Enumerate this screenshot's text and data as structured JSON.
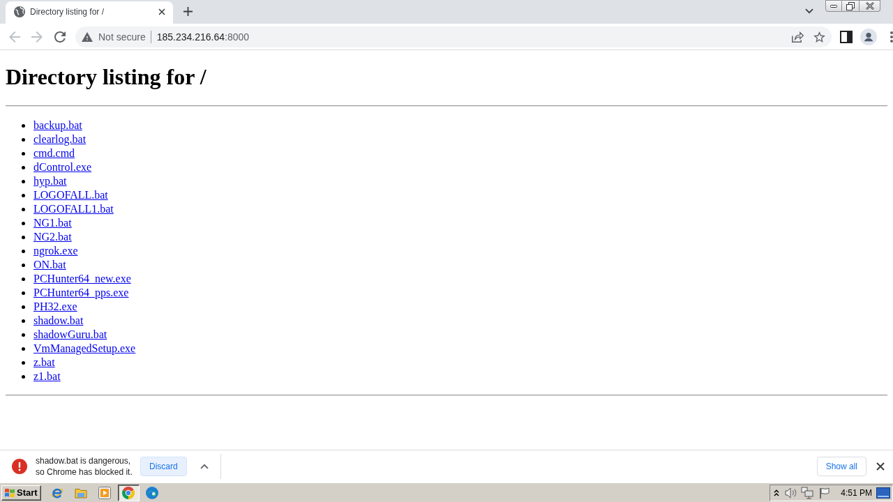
{
  "browser": {
    "tabs": [
      {
        "title": "Directory listing for /",
        "selected": true
      }
    ],
    "nav": [
      {
        "kind": "back",
        "disabled": true
      },
      {
        "kind": "forward",
        "disabled": true
      },
      {
        "kind": "reload",
        "disabled": false
      }
    ],
    "address_bar": {
      "security_label": "Not secure",
      "host": "185.234.216.64",
      "port": ":8000"
    }
  },
  "page": {
    "heading": "Directory listing for /",
    "files": [
      "backup.bat",
      "clearlog.bat",
      "cmd.cmd",
      "dControl.exe",
      "hyp.bat",
      "LOGOFALL.bat",
      "LOGOFALL1.bat",
      "NG1.bat",
      "NG2.bat",
      "ngrok.exe",
      "ON.bat",
      "PCHunter64_new.exe",
      "PCHunter64_pps.exe",
      "PH32.exe",
      "shadow.bat",
      "shadowGuru.bat",
      "VmManagedSetup.exe",
      "z.bat",
      "z1.bat"
    ]
  },
  "download_bar": {
    "message": "shadow.bat is dangerous, so Chrome has blocked it.",
    "discard_button": "Discard",
    "show_all_button": "Show all"
  },
  "taskbar": {
    "start": "Start",
    "apps": [
      {
        "kind": "ie",
        "selected": false
      },
      {
        "kind": "folder",
        "selected": false
      },
      {
        "kind": "media",
        "selected": false
      },
      {
        "kind": "chrome",
        "selected": true
      },
      {
        "kind": "edge",
        "selected": false
      }
    ],
    "clock": "4:51 PM"
  }
}
